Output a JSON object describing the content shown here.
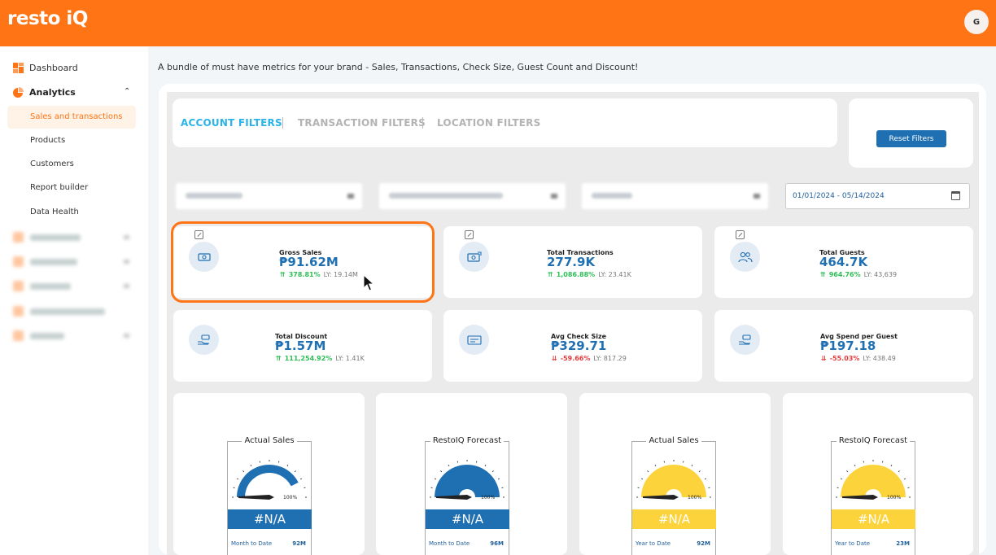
{
  "app": {
    "brand": "resto iQ",
    "user_initial": "G"
  },
  "sidebar": {
    "dashboard": "Dashboard",
    "analytics": "Analytics",
    "analytics_sub": [
      "Sales and transactions",
      "Products",
      "Customers",
      "Report builder",
      "Data Health"
    ],
    "active_item": "Sales and transactions"
  },
  "intro": "A bundle of must have metrics for your brand - Sales, Transactions, Check Size, Guest Count and Discount!",
  "filters": {
    "tabs": [
      "ACCOUNT FILTERS",
      "TRANSACTION FILTERS",
      "LOCATION FILTERS"
    ],
    "reset_label": "Reset Filters",
    "date_range": "01/01/2024 - 05/14/2024"
  },
  "kpis": [
    {
      "label": "Gross Sales",
      "value": "₱91.62M",
      "change": "378.81%",
      "direction": "up",
      "ly": "LY: 19.14M",
      "icon": "money-icon"
    },
    {
      "label": "Total Transactions",
      "value": "277.9K",
      "change": "1,086.88%",
      "direction": "up",
      "ly": "LY: 23.41K",
      "icon": "cash-exchange-icon"
    },
    {
      "label": "Total Guests",
      "value": "464.7K",
      "change": "964.76%",
      "direction": "up",
      "ly": "LY: 43,639",
      "icon": "users-icon"
    },
    {
      "label": "Total Discount",
      "value": "₱1.57M",
      "change": "111,254.92%",
      "direction": "up",
      "ly": "LY: 1.41K",
      "icon": "hand-money-icon"
    },
    {
      "label": "Avg Check Size",
      "value": "₱329.71",
      "change": "-59.66%",
      "direction": "down",
      "ly": "LY: 817.29",
      "icon": "receipt-icon"
    },
    {
      "label": "Avg Spend per Guest",
      "value": "₱197.18",
      "change": "-55.03%",
      "direction": "down",
      "ly": "LY: 438.49",
      "icon": "hand-money-icon"
    }
  ],
  "gauges": [
    {
      "title": "Actual Sales",
      "pct_label": "100%",
      "value": "#N/A",
      "period": "Month to Date",
      "amount": "92M",
      "color": "#1f6fb3",
      "fill": 0.85
    },
    {
      "title": "RestoIQ Forecast",
      "pct_label": "100%",
      "value": "#N/A",
      "period": "Month to Date",
      "amount": "96M",
      "color": "#1f6fb3",
      "fill": 1.0
    },
    {
      "title": "Actual Sales",
      "pct_label": "100%",
      "value": "#N/A",
      "period": "Year to Date",
      "amount": "92M",
      "color": "#fdd33c",
      "fill": 1.0
    },
    {
      "title": "RestoIQ Forecast",
      "pct_label": "100%",
      "value": "#N/A",
      "period": "Year to Date",
      "amount": "23M",
      "color": "#fdd33c",
      "fill": 1.0
    }
  ]
}
